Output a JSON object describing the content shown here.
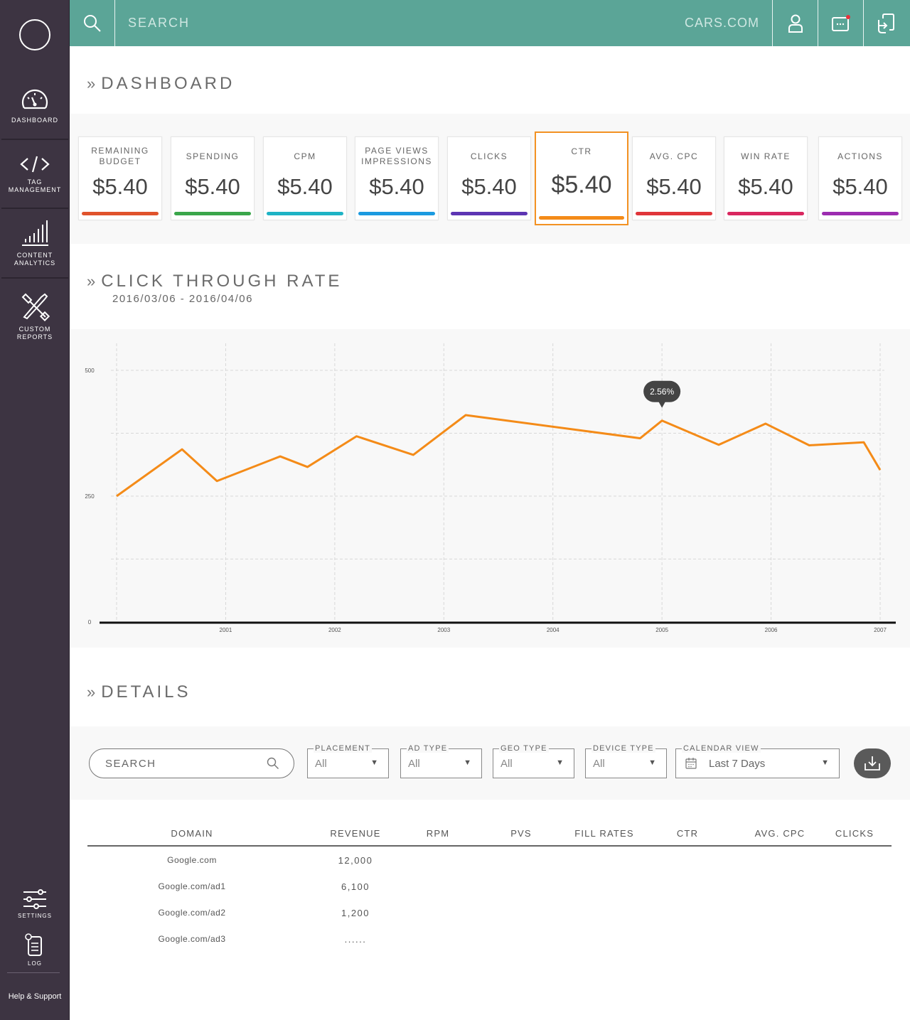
{
  "sidebar": {
    "items": [
      {
        "label": "DASHBOARD",
        "icon": "speedometer-icon"
      },
      {
        "label_line1": "TAG",
        "label_line2": "MANAGEMENT",
        "icon": "code-icon"
      },
      {
        "label_line1": "CONTENT",
        "label_line2": "ANALYTICS",
        "icon": "bar-chart-icon"
      },
      {
        "label_line1": "CUSTOM",
        "label_line2": "REPORTS",
        "icon": "tools-icon"
      }
    ],
    "settings_label": "SETTINGS",
    "log_label": "LOG",
    "help_label": "Help & Support"
  },
  "topbar": {
    "search_placeholder": "SEARCH",
    "brand": "CARS.COM"
  },
  "dashboard": {
    "title": "DASHBOARD",
    "kpis": [
      {
        "label": "REMAINING BUDGET",
        "value": "$5.40",
        "color": "#e0532c"
      },
      {
        "label": "SPENDING",
        "value": "$5.40",
        "color": "#3aa64a"
      },
      {
        "label": "CPM",
        "value": "$5.40",
        "color": "#1eb3c5"
      },
      {
        "label": "PAGE VIEWS IMPRESSIONS",
        "value": "$5.40",
        "color": "#1b9ae0"
      },
      {
        "label": "CLICKS",
        "value": "$5.40",
        "color": "#5d35b3"
      },
      {
        "label": "CTR",
        "value": "$5.40",
        "color": "#f48b18"
      },
      {
        "label": "AVG. CPC",
        "value": "$5.40",
        "color": "#e0353a"
      },
      {
        "label": "WIN RATE",
        "value": "$5.40",
        "color": "#d9275f"
      },
      {
        "label": "ACTIONS",
        "value": "$5.40",
        "color": "#9c2cb0"
      }
    ],
    "active_kpi": "CTR"
  },
  "ctr_section": {
    "title": "CLICK THROUGH RATE",
    "date_range": "2016/03/06 - 2016/04/06",
    "tooltip": "2.56%"
  },
  "chart_data": {
    "type": "line",
    "ylim": [
      0,
      500
    ],
    "yticks": [
      "0",
      "250",
      "500"
    ],
    "xticks": [
      "2001",
      "2002",
      "2003",
      "2004",
      "2005",
      "2006",
      "2007"
    ],
    "color": "#f48b18",
    "series": [
      {
        "x": [
          2000.0,
          2000.6,
          2000.92,
          2001.5,
          2001.75,
          2002.2,
          2002.72,
          2003.2,
          2004.8,
          2005.0,
          2005.52,
          2005.95,
          2006.35,
          2006.85,
          2007.0
        ],
        "values": [
          250,
          343,
          280,
          329,
          308,
          369,
          332,
          411,
          365,
          400,
          352,
          394,
          351,
          357,
          302
        ]
      }
    ]
  },
  "details": {
    "title": "DETAILS",
    "search_placeholder": "SEARCH",
    "filters": [
      {
        "label": "PLACEMENT",
        "value": "All"
      },
      {
        "label": "AD TYPE",
        "value": "All"
      },
      {
        "label": "GEO TYPE",
        "value": "All"
      },
      {
        "label": "DEVICE TYPE",
        "value": "All"
      }
    ],
    "calendar": {
      "label": "CALENDAR VIEW",
      "value": "Last 7 Days"
    },
    "table": {
      "columns": [
        "DOMAIN",
        "REVENUE",
        "RPM",
        "PVS",
        "FILL RATES",
        "CTR",
        "AVG. CPC",
        "CLICKS"
      ],
      "rows": [
        {
          "domain": "Google.com",
          "revenue": "12,000"
        },
        {
          "domain": "Google.com/ad1",
          "revenue": "6,100"
        },
        {
          "domain": "Google.com/ad2",
          "revenue": "1,200"
        },
        {
          "domain": "Google.com/ad3",
          "revenue": "......"
        }
      ]
    }
  }
}
